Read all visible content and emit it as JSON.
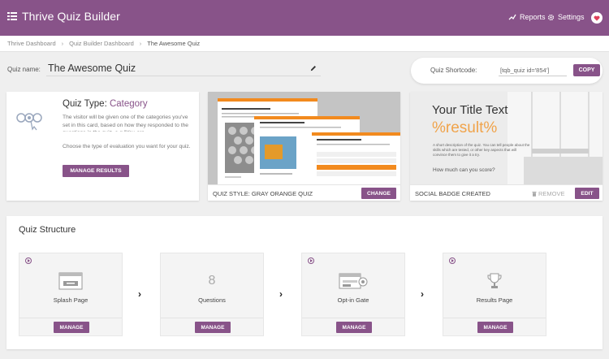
{
  "header": {
    "title": "Thrive Quiz Builder",
    "reports": "Reports",
    "settings": "Settings"
  },
  "breadcrumb": [
    "Thrive Dashboard",
    "Quiz Builder Dashboard",
    "The Awesome Quiz"
  ],
  "quiz": {
    "name_label": "Quiz name:",
    "name": "The Awesome Quiz",
    "shortcode_label": "Quiz Shortcode:",
    "shortcode": "[tqb_quiz id='854']",
    "copy": "COPY"
  },
  "quiz_type": {
    "title_prefix": "Quiz Type:",
    "type": "Category",
    "description": "The visitor will be given one of the categories you've set in this card, based on how they responded to the questions in the quiz. e.g \"You are",
    "instruction": "Choose the type of evaluation you want for your quiz.",
    "button": "MANAGE RESULTS"
  },
  "quiz_style": {
    "label": "QUIZ STYLE: GRAY ORANGE QUIZ",
    "button": "CHANGE",
    "preview_heading": "Question content goes here"
  },
  "badge": {
    "title": "Your Title Text",
    "result": "%result%",
    "description": "A short description of the quiz. You can tell people about the skills which are tested, or other key aspects that will convince them to give it a try.",
    "question": "How much can you score?",
    "label": "SOCIAL BADGE CREATED",
    "remove": "REMOVE",
    "edit": "EDIT"
  },
  "structure": {
    "title": "Quiz Structure",
    "steps": [
      {
        "label": "Splash Page",
        "button": "MANAGE"
      },
      {
        "label": "Questions",
        "count": "8",
        "button": "MANAGE"
      },
      {
        "label": "Opt-in Gate",
        "button": "MANAGE"
      },
      {
        "label": "Results Page",
        "button": "MANAGE"
      }
    ]
  },
  "colors": {
    "brand": "#885389",
    "accent_orange": "#f0a34a"
  }
}
